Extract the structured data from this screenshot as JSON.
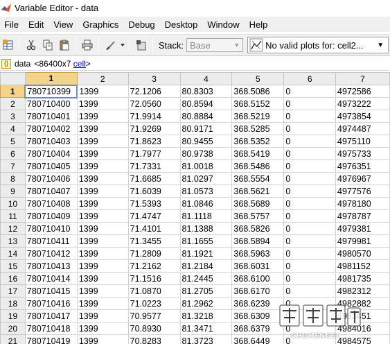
{
  "window": {
    "title": "Variable Editor - data"
  },
  "menu": [
    "File",
    "Edit",
    "View",
    "Graphics",
    "Debug",
    "Desktop",
    "Window",
    "Help"
  ],
  "toolbar": {
    "stack_label": "Stack:",
    "stack_value": "Base",
    "plots_label": "No valid plots for: cell2..."
  },
  "variable": {
    "name": "data",
    "dims": "<86400x7",
    "class": "cell",
    "close": ">"
  },
  "grid": {
    "columns": [
      "1",
      "2",
      "3",
      "4",
      "5",
      "6",
      "7"
    ],
    "rows": [
      {
        "n": "1",
        "cells": [
          "780710399",
          "1399",
          "72.1206",
          "80.8303",
          "368.5086",
          "0",
          "4972586"
        ]
      },
      {
        "n": "2",
        "cells": [
          "780710400",
          "1399",
          "72.0560",
          "80.8594",
          "368.5152",
          "0",
          "4973222"
        ]
      },
      {
        "n": "3",
        "cells": [
          "780710401",
          "1399",
          "71.9914",
          "80.8884",
          "368.5219",
          "0",
          "4973854"
        ]
      },
      {
        "n": "4",
        "cells": [
          "780710402",
          "1399",
          "71.9269",
          "80.9171",
          "368.5285",
          "0",
          "4974487"
        ]
      },
      {
        "n": "5",
        "cells": [
          "780710403",
          "1399",
          "71.8623",
          "80.9455",
          "368.5352",
          "0",
          "4975110"
        ]
      },
      {
        "n": "6",
        "cells": [
          "780710404",
          "1399",
          "71.7977",
          "80.9738",
          "368.5419",
          "0",
          "4975733"
        ]
      },
      {
        "n": "7",
        "cells": [
          "780710405",
          "1399",
          "71.7331",
          "81.0018",
          "368.5486",
          "0",
          "4976351"
        ]
      },
      {
        "n": "8",
        "cells": [
          "780710406",
          "1399",
          "71.6685",
          "81.0297",
          "368.5554",
          "0",
          "4976967"
        ]
      },
      {
        "n": "9",
        "cells": [
          "780710407",
          "1399",
          "71.6039",
          "81.0573",
          "368.5621",
          "0",
          "4977576"
        ]
      },
      {
        "n": "10",
        "cells": [
          "780710408",
          "1399",
          "71.5393",
          "81.0846",
          "368.5689",
          "0",
          "4978180"
        ]
      },
      {
        "n": "11",
        "cells": [
          "780710409",
          "1399",
          "71.4747",
          "81.1118",
          "368.5757",
          "0",
          "4978787"
        ]
      },
      {
        "n": "12",
        "cells": [
          "780710410",
          "1399",
          "71.4101",
          "81.1388",
          "368.5826",
          "0",
          "4979381"
        ]
      },
      {
        "n": "13",
        "cells": [
          "780710411",
          "1399",
          "71.3455",
          "81.1655",
          "368.5894",
          "0",
          "4979981"
        ]
      },
      {
        "n": "14",
        "cells": [
          "780710412",
          "1399",
          "71.2809",
          "81.1921",
          "368.5963",
          "0",
          "4980570"
        ]
      },
      {
        "n": "15",
        "cells": [
          "780710413",
          "1399",
          "71.2162",
          "81.2184",
          "368.6031",
          "0",
          "4981152"
        ]
      },
      {
        "n": "16",
        "cells": [
          "780710414",
          "1399",
          "71.1516",
          "81.2445",
          "368.6100",
          "0",
          "4981735"
        ]
      },
      {
        "n": "17",
        "cells": [
          "780710415",
          "1399",
          "71.0870",
          "81.2705",
          "368.6170",
          "0",
          "4982312"
        ]
      },
      {
        "n": "18",
        "cells": [
          "780710416",
          "1399",
          "71.0223",
          "81.2962",
          "368.6239",
          "0",
          "4982882"
        ]
      },
      {
        "n": "19",
        "cells": [
          "780710417",
          "1399",
          "70.9577",
          "81.3218",
          "368.6309",
          "0",
          "4983451"
        ]
      },
      {
        "n": "20",
        "cells": [
          "780710418",
          "1399",
          "70.8930",
          "81.3471",
          "368.6379",
          "0",
          "4984016"
        ]
      },
      {
        "n": "21",
        "cells": [
          "780710419",
          "1399",
          "70.8283",
          "81.3723",
          "368.6449",
          "0",
          "4984575"
        ]
      }
    ]
  },
  "watermark": {
    "text": "CHUMENGSI"
  },
  "colors": {
    "header_bg": "#ececec",
    "header_active": "#f3d48a",
    "selection_border": "#6a8fd0",
    "link": "#0000ee"
  }
}
